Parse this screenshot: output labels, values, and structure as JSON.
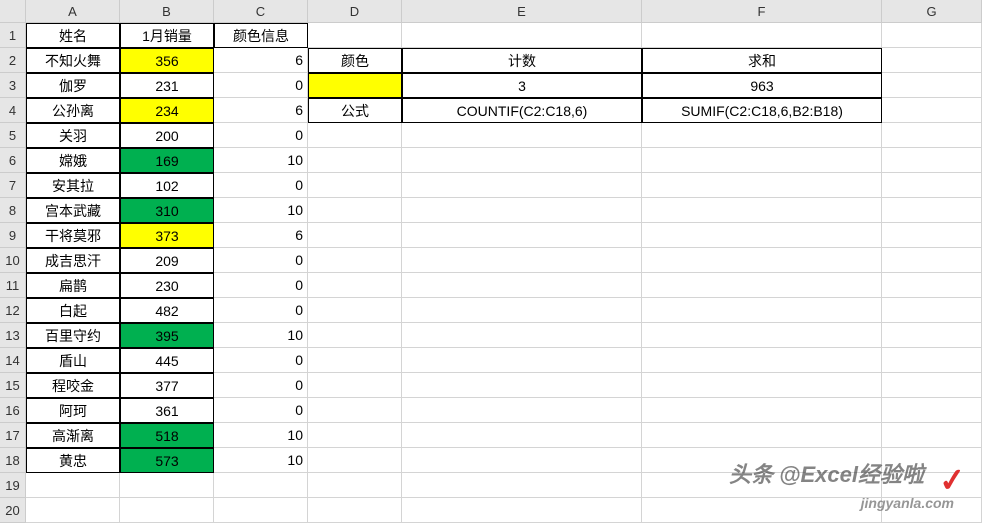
{
  "columns": [
    "A",
    "B",
    "C",
    "D",
    "E",
    "F",
    "G"
  ],
  "rowcount": 20,
  "headers": {
    "A1": "姓名",
    "B1": "1月销量",
    "C1": "颜色信息"
  },
  "summary": {
    "D2": "颜色",
    "E2": "计数",
    "F2": "求和",
    "E3": "3",
    "F3": "963",
    "D4": "公式",
    "E4": "COUNTIF(C2:C18,6)",
    "F4": "SUMIF(C2:C18,6,B2:B18)"
  },
  "data": [
    {
      "name": "不知火舞",
      "sales": "356",
      "color": "6",
      "fill": "yellow"
    },
    {
      "name": "伽罗",
      "sales": "231",
      "color": "0",
      "fill": ""
    },
    {
      "name": "公孙离",
      "sales": "234",
      "color": "6",
      "fill": "yellow"
    },
    {
      "name": "关羽",
      "sales": "200",
      "color": "0",
      "fill": ""
    },
    {
      "name": "嫦娥",
      "sales": "169",
      "color": "10",
      "fill": "green"
    },
    {
      "name": "安其拉",
      "sales": "102",
      "color": "0",
      "fill": ""
    },
    {
      "name": "宫本武藏",
      "sales": "310",
      "color": "10",
      "fill": "green"
    },
    {
      "name": "干将莫邪",
      "sales": "373",
      "color": "6",
      "fill": "yellow"
    },
    {
      "name": "成吉思汗",
      "sales": "209",
      "color": "0",
      "fill": ""
    },
    {
      "name": "扁鹊",
      "sales": "230",
      "color": "0",
      "fill": ""
    },
    {
      "name": "白起",
      "sales": "482",
      "color": "0",
      "fill": ""
    },
    {
      "name": "百里守约",
      "sales": "395",
      "color": "10",
      "fill": "green"
    },
    {
      "name": "盾山",
      "sales": "445",
      "color": "0",
      "fill": ""
    },
    {
      "name": "程咬金",
      "sales": "377",
      "color": "0",
      "fill": ""
    },
    {
      "name": "阿珂",
      "sales": "361",
      "color": "0",
      "fill": ""
    },
    {
      "name": "高渐离",
      "sales": "518",
      "color": "10",
      "fill": "green"
    },
    {
      "name": "黄忠",
      "sales": "573",
      "color": "10",
      "fill": "green"
    }
  ],
  "watermark": {
    "line1": "头条 @Excel经验啦",
    "line2": "jingyanla.com",
    "check": "✓"
  }
}
